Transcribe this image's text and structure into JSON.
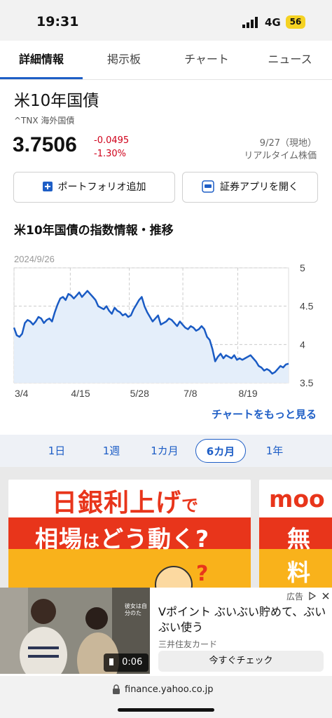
{
  "status_bar": {
    "time": "19:31",
    "network": "4G",
    "battery": "56"
  },
  "tabs": [
    {
      "label": "詳細情報",
      "active": true
    },
    {
      "label": "掲示板",
      "active": false
    },
    {
      "label": "チャート",
      "active": false
    },
    {
      "label": "ニュース",
      "active": false
    }
  ],
  "quote": {
    "name": "米10年国債",
    "symbol_line": "^TNX 海外国債",
    "price": "3.7506",
    "change": "-0.0495",
    "change_pct": "-1.30%",
    "date": "9/27（現地）",
    "realtime": "リアルタイム株価"
  },
  "buttons": {
    "portfolio": "ポートフォリオ追加",
    "app": "証券アプリを開く"
  },
  "section_title": "米10年国債の指数情報・推移",
  "chart_data": {
    "type": "area",
    "date_label": "2024/9/26",
    "x_ticks": [
      "3/4",
      "4/15",
      "5/28",
      "7/8",
      "8/19"
    ],
    "y_ticks": [
      "5",
      "4.5",
      "4",
      "3.5"
    ],
    "ylim": [
      3.5,
      5.0
    ],
    "grid": true,
    "color": "#1a5bc4",
    "values": [
      4.22,
      4.12,
      4.1,
      4.14,
      4.28,
      4.32,
      4.3,
      4.26,
      4.3,
      4.36,
      4.34,
      4.28,
      4.32,
      4.34,
      4.3,
      4.42,
      4.52,
      4.6,
      4.62,
      4.58,
      4.66,
      4.64,
      4.6,
      4.64,
      4.68,
      4.62,
      4.66,
      4.7,
      4.66,
      4.62,
      4.58,
      4.5,
      4.48,
      4.46,
      4.5,
      4.44,
      4.4,
      4.48,
      4.44,
      4.42,
      4.38,
      4.4,
      4.36,
      4.38,
      4.46,
      4.52,
      4.58,
      4.62,
      4.5,
      4.42,
      4.36,
      4.3,
      4.34,
      4.38,
      4.26,
      4.28,
      4.3,
      4.34,
      4.32,
      4.28,
      4.24,
      4.3,
      4.26,
      4.22,
      4.2,
      4.24,
      4.22,
      4.18,
      4.2,
      4.24,
      4.2,
      4.1,
      4.06,
      3.94,
      3.78,
      3.84,
      3.88,
      3.82,
      3.86,
      3.84,
      3.82,
      3.86,
      3.8,
      3.82,
      3.8,
      3.82,
      3.84,
      3.86,
      3.82,
      3.78,
      3.72,
      3.7,
      3.66,
      3.68,
      3.66,
      3.62,
      3.64,
      3.68,
      3.72,
      3.7,
      3.74,
      3.75
    ]
  },
  "chart_more": "チャートをもっと見る",
  "periods": [
    {
      "label": "1日",
      "active": false
    },
    {
      "label": "1週",
      "active": false
    },
    {
      "label": "1カ月",
      "active": false
    },
    {
      "label": "6カ月",
      "active": true
    },
    {
      "label": "1年",
      "active": false
    }
  ],
  "banners": {
    "b1_top_big": "日銀利上げ",
    "b1_top_small": "で",
    "b1_mid_a": "相場",
    "b1_mid_small": "は",
    "b1_mid_b": "どう動く?",
    "b2_top": "moo",
    "b2_mid": "無料"
  },
  "ad": {
    "label": "広告",
    "title": "Vポイント ぶいぶい貯めて、ぶいぶい使う",
    "sponsor": "三井住友カード",
    "cta": "今すぐチェック",
    "video_time": "0:06",
    "video_caption": "彼女は自分のた"
  },
  "url": "finance.yahoo.co.jp"
}
